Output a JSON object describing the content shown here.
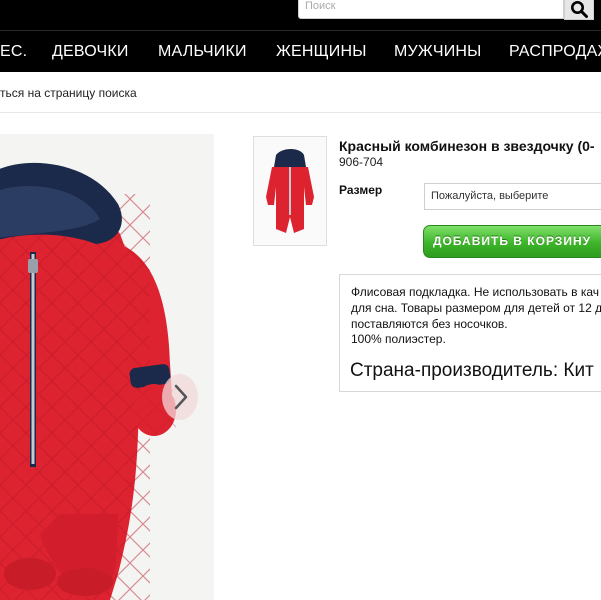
{
  "header": {
    "search_placeholder": "Поиск",
    "nav": [
      "ЕС.",
      "ДЕВОЧКИ",
      "МАЛЬЧИКИ",
      "ЖЕНЩИНЫ",
      "МУЖЧИНЫ",
      "РАСПРОДАЖ"
    ]
  },
  "breadcrumb": "ться на страницу поиска",
  "product": {
    "title": "Красный комбинезон в звездочку (0-",
    "sku": "906-704",
    "size_label": "Размер",
    "size_select_value": "Пожалуйста, выберите",
    "add_to_cart": "ДОБАВИТЬ В КОРЗИНУ",
    "description_lines": [
      "Флисовая подкладка. Не использовать в кач",
      "для сна. Товары размером для детей от 12 д",
      "поставляются без носочков.",
      "100% полиэстер."
    ],
    "country": "Страна-производитель: Кит"
  },
  "colors": {
    "nav_bg": "#000000",
    "garment_red": "#dd2230",
    "hood_navy": "#1b2a4a",
    "button_green": "#3db42a"
  },
  "icons": {
    "search": "magnifier-icon",
    "next": "chevron-right-icon"
  }
}
